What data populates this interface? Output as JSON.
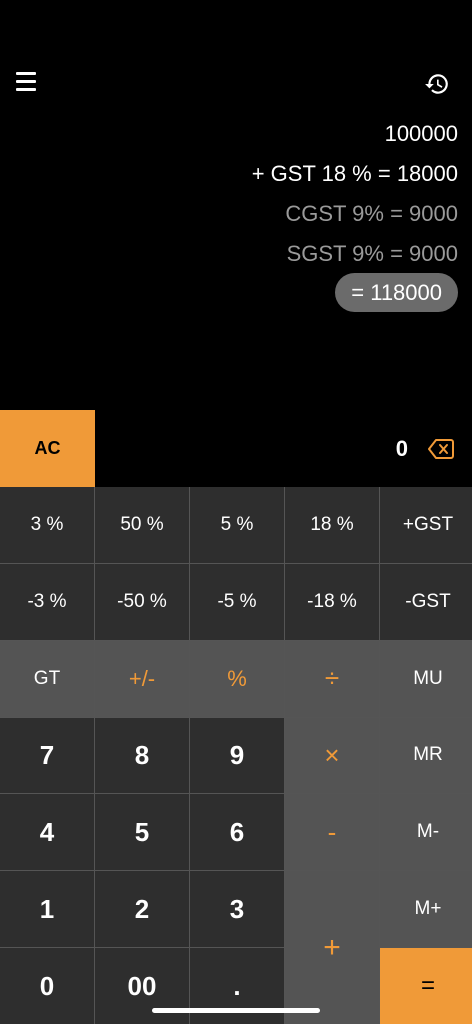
{
  "header": {
    "menu_icon": "hamburger-menu-icon",
    "history_icon": "history-icon"
  },
  "results": {
    "input": "100000",
    "gst_line": "+ GST 18 % = 18000",
    "cgst_line": "CGST 9% = 9000",
    "sgst_line": "SGST 9% = 9000",
    "total": "= 118000"
  },
  "display": {
    "ac_label": "AC",
    "value": "0",
    "backspace_icon": "backspace-icon"
  },
  "keys": {
    "p3": "3 %",
    "p50": "50 %",
    "p5": "5 %",
    "p18": "18 %",
    "plus_gst": "+GST",
    "m3": "-3 %",
    "m50": "-50 %",
    "m5": "-5 %",
    "m18": "-18 %",
    "minus_gst": "-GST",
    "gt": "GT",
    "plusminus": "+/-",
    "percent": "%",
    "divide": "÷",
    "mu": "MU",
    "seven": "7",
    "eight": "8",
    "nine": "9",
    "multiply": "×",
    "mr": "MR",
    "four": "4",
    "five": "5",
    "six": "6",
    "minus": "-",
    "mminus": "M-",
    "one": "1",
    "two": "2",
    "three": "3",
    "plus": "+",
    "mplus": "M+",
    "zero": "0",
    "double_zero": "00",
    "dot": ".",
    "equals": "="
  },
  "colors": {
    "accent": "#f09a38",
    "key_dark": "#2e2e2e",
    "key_mid": "#545454",
    "pill": "#6b6b6b"
  }
}
